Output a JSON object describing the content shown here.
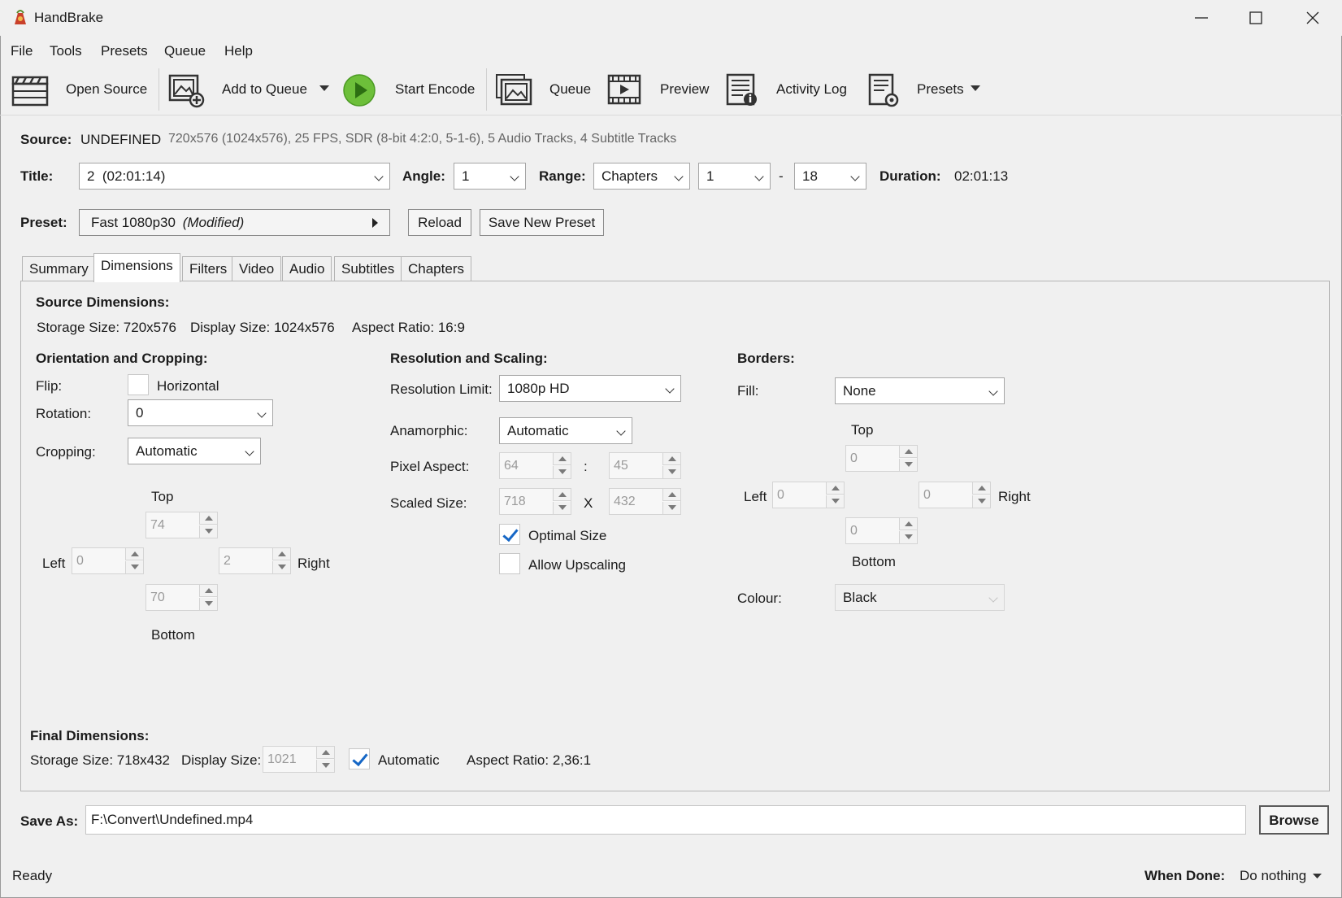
{
  "window": {
    "title": "HandBrake",
    "minimize_icon": "minimize-icon",
    "maximize_icon": "maximize-icon",
    "close_icon": "close-icon"
  },
  "menu": [
    "File",
    "Tools",
    "Presets",
    "Queue",
    "Help"
  ],
  "toolbar": {
    "open_source": "Open Source",
    "add_to_queue": "Add to Queue",
    "start_encode": "Start Encode",
    "queue": "Queue",
    "preview": "Preview",
    "activity_log": "Activity Log",
    "presets": "Presets",
    "start_encode_color": "#6dbf3a"
  },
  "source": {
    "label": "Source:",
    "name": "UNDEFINED",
    "info": "720x576 (1024x576), 25 FPS, SDR (8-bit 4:2:0, 5-1-6), 5 Audio Tracks, 4 Subtitle Tracks"
  },
  "title_row": {
    "title_label": "Title:",
    "title_value": "2  (02:01:14)",
    "angle_label": "Angle:",
    "angle_value": "1",
    "range_label": "Range:",
    "range_value": "Chapters",
    "range_start": "1",
    "range_dash": "-",
    "range_end": "18",
    "duration_label": "Duration:",
    "duration_value": "02:01:13"
  },
  "preset_row": {
    "label": "Preset:",
    "value": "Fast 1080p30",
    "modified": "(Modified)",
    "reload": "Reload",
    "save_new": "Save New Preset"
  },
  "tabs": [
    "Summary",
    "Dimensions",
    "Filters",
    "Video",
    "Audio",
    "Subtitles",
    "Chapters"
  ],
  "active_tab": "Dimensions",
  "dimensions": {
    "source_heading": "Source Dimensions:",
    "storage_size": "Storage Size: 720x576",
    "display_size": "Display Size: 1024x576",
    "aspect_ratio": "Aspect Ratio: 16:9",
    "orientation": {
      "heading": "Orientation and Cropping:",
      "flip_label": "Flip:",
      "flip_option": "Horizontal",
      "flip_checked": false,
      "rotation_label": "Rotation:",
      "rotation_value": "0",
      "cropping_label": "Cropping:",
      "cropping_value": "Automatic",
      "top_label": "Top",
      "top_value": "74",
      "left_label": "Left",
      "left_value": "0",
      "right_label": "Right",
      "right_value": "2",
      "bottom_label": "Bottom",
      "bottom_value": "70"
    },
    "resolution": {
      "heading": "Resolution and Scaling:",
      "limit_label": "Resolution Limit:",
      "limit_value": "1080p HD",
      "anamorphic_label": "Anamorphic:",
      "anamorphic_value": "Automatic",
      "pixel_aspect_label": "Pixel Aspect:",
      "pixel_aspect_w": "64",
      "pixel_aspect_sep": ":",
      "pixel_aspect_h": "45",
      "scaled_label": "Scaled Size:",
      "scaled_w": "718",
      "scaled_sep": "X",
      "scaled_h": "432",
      "optimal_size": "Optimal Size",
      "optimal_checked": true,
      "allow_upscaling": "Allow Upscaling",
      "upscaling_checked": false
    },
    "borders": {
      "heading": "Borders:",
      "fill_label": "Fill:",
      "fill_value": "None",
      "top_label": "Top",
      "top_value": "0",
      "left_label": "Left",
      "left_value": "0",
      "right_label": "Right",
      "right_value": "0",
      "bottom_label": "Bottom",
      "bottom_value": "0",
      "colour_label": "Colour:",
      "colour_value": "Black"
    },
    "final": {
      "heading": "Final Dimensions:",
      "storage_size": "Storage Size: 718x432",
      "display_label": "Display Size:",
      "display_value": "1021",
      "automatic": "Automatic",
      "automatic_checked": true,
      "aspect_ratio": "Aspect Ratio: 2,36:1"
    }
  },
  "save_as": {
    "label": "Save As:",
    "path": "F:\\Convert\\Undefined.mp4",
    "browse": "Browse"
  },
  "status": {
    "text": "Ready",
    "when_done_label": "When Done:",
    "when_done_value": "Do nothing"
  }
}
